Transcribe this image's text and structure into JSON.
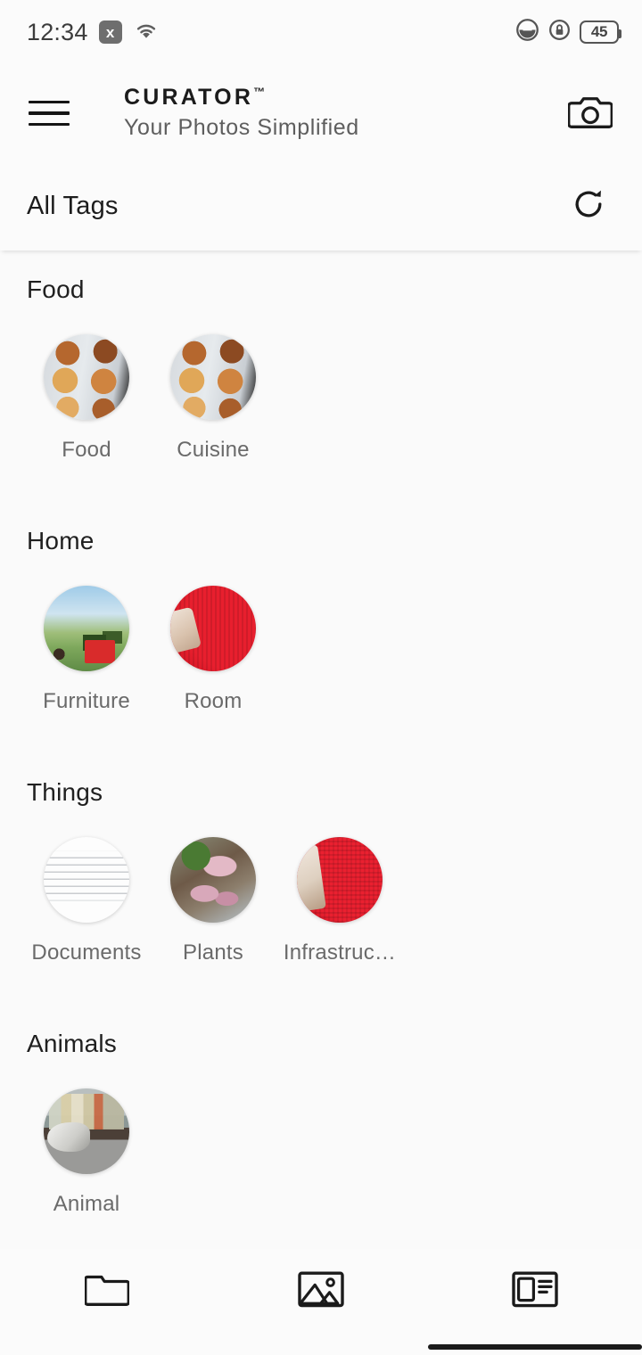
{
  "status_bar": {
    "time": "12:34",
    "x_badge_label": "x",
    "wifi_icon": "wifi-icon",
    "dnd_icon": "do-not-disturb-icon",
    "rotation_lock_icon": "rotation-lock-icon",
    "battery_level": "45"
  },
  "app_bar": {
    "menu_icon": "hamburger-menu-icon",
    "brand_name": "CURATOR",
    "brand_trademark": "™",
    "tagline": "Your Photos Simplified",
    "camera_icon": "camera-icon"
  },
  "tag_bar": {
    "title": "All Tags",
    "refresh_icon": "refresh-icon"
  },
  "sections": [
    {
      "title": "Food",
      "tiles": [
        {
          "label": "Food",
          "art": "art-muffin"
        },
        {
          "label": "Cuisine",
          "art": "art-muffin"
        }
      ]
    },
    {
      "title": "Home",
      "tiles": [
        {
          "label": "Furniture",
          "art": "art-furniture"
        },
        {
          "label": "Room",
          "art": "art-red"
        }
      ]
    },
    {
      "title": "Things",
      "tiles": [
        {
          "label": "Documents",
          "art": "art-doc"
        },
        {
          "label": "Plants",
          "art": "art-plant"
        },
        {
          "label": "Infrastruc…",
          "art": "art-red2"
        }
      ]
    },
    {
      "title": "Animals",
      "tiles": [
        {
          "label": "Animal",
          "art": "art-animal"
        }
      ]
    }
  ],
  "bottom_nav": [
    {
      "icon": "folder-icon"
    },
    {
      "icon": "image-icon"
    },
    {
      "icon": "article-card-icon"
    }
  ],
  "colors": {
    "page_background": "#fafafa",
    "bar_background": "#fbfbfb",
    "primary_text": "#1b1b1b",
    "secondary_text": "#6a6a6a",
    "accent_red": "#e81f2e"
  }
}
